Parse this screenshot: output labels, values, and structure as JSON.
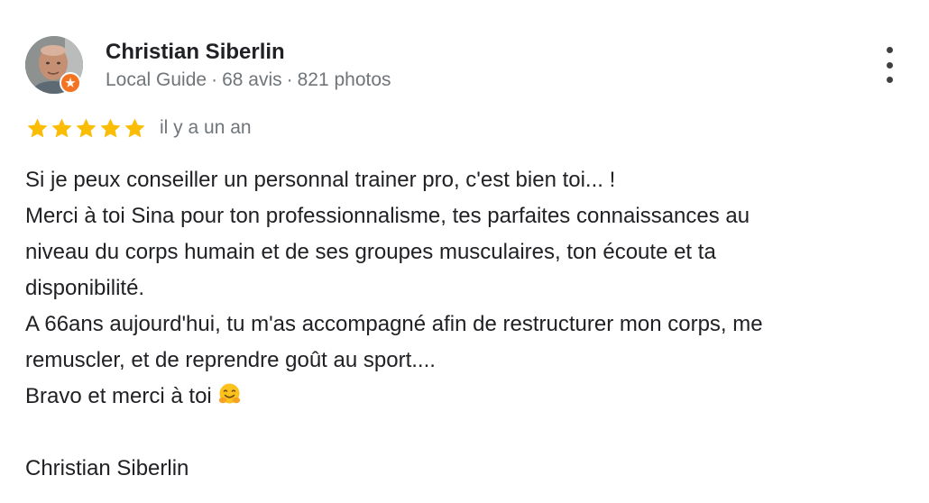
{
  "review": {
    "author": {
      "name": "Christian Siberlin",
      "level": "Local Guide",
      "reviews": "68 avis",
      "photos": "821 photos",
      "separator": "·"
    },
    "rating": 5,
    "date": "il y a un an",
    "body_lines": [
      "Si je peux conseiller un personnal trainer pro, c'est bien toi... !",
      "Merci à toi Sina pour ton professionnalisme, tes parfaites connaissances au",
      "niveau du corps humain et de ses groupes musculaires, ton écoute et ta",
      "disponibilité.",
      "A 66ans aujourd'hui, tu m'as accompagné afin de restructurer mon corps, me",
      "remuscler, et de reprendre goût au sport....",
      "Bravo et merci à toi"
    ],
    "signature": "Christian Siberlin"
  },
  "icons": {
    "more": "more-vert-icon",
    "star": "star-icon",
    "badge": "local-guide-badge-icon",
    "emoji": "hugging-face-emoji"
  },
  "colors": {
    "star": "#fbbc04",
    "badge": "#f37321",
    "meta_text": "#70757a",
    "body_text": "#202124"
  }
}
